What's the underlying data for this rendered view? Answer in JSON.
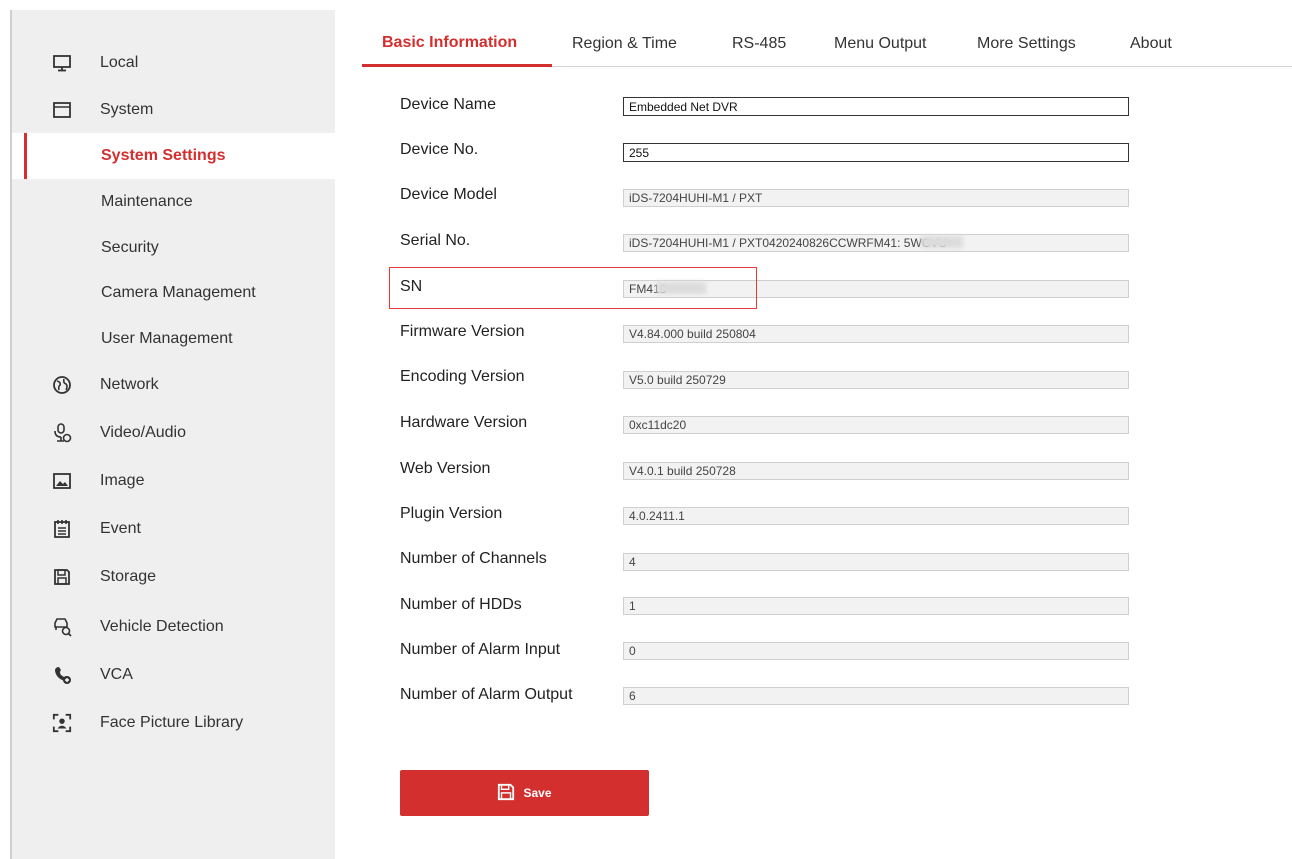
{
  "sidebar": {
    "items": [
      {
        "label": "Local",
        "icon": "monitor-icon"
      },
      {
        "label": "System",
        "icon": "window-icon"
      },
      {
        "label": "System Settings"
      },
      {
        "label": "Maintenance"
      },
      {
        "label": "Security"
      },
      {
        "label": "Camera Management"
      },
      {
        "label": "User Management"
      },
      {
        "label": "Network",
        "icon": "globe-icon"
      },
      {
        "label": "Video/Audio",
        "icon": "microphone-camera-icon"
      },
      {
        "label": "Image",
        "icon": "image-icon"
      },
      {
        "label": "Event",
        "icon": "calendar-icon"
      },
      {
        "label": "Storage",
        "icon": "floppy-icon"
      },
      {
        "label": "Vehicle Detection",
        "icon": "vehicle-search-icon"
      },
      {
        "label": "VCA",
        "icon": "vca-icon"
      },
      {
        "label": "Face Picture Library",
        "icon": "face-frame-icon"
      }
    ],
    "active_index": 2
  },
  "tabs": [
    {
      "label": "Basic Information"
    },
    {
      "label": "Region & Time"
    },
    {
      "label": "RS-485"
    },
    {
      "label": "Menu Output"
    },
    {
      "label": "More Settings"
    },
    {
      "label": "About"
    }
  ],
  "form": {
    "rows": [
      {
        "label": "Device Name",
        "value": "Embedded Net DVR"
      },
      {
        "label": "Device No.",
        "value": "255"
      },
      {
        "label": "Device Model",
        "value": "iDS-7204HUHI-M1 / PXT"
      },
      {
        "label": "Serial No.",
        "value": "iDS-7204HUHI-M1 / PXT0420240826CCWRFM41:    5WCVU"
      },
      {
        "label": "SN",
        "value": "FM413"
      },
      {
        "label": "Firmware Version",
        "value": "V4.84.000 build 250804"
      },
      {
        "label": "Encoding Version",
        "value": "V5.0 build 250729"
      },
      {
        "label": "Hardware Version",
        "value": "0xc11dc20"
      },
      {
        "label": "Web Version",
        "value": "V4.0.1 build 250728"
      },
      {
        "label": "Plugin Version",
        "value": "4.0.2411.1"
      },
      {
        "label": "Number of Channels",
        "value": "4"
      },
      {
        "label": "Number of HDDs",
        "value": "1"
      },
      {
        "label": "Number of Alarm Input",
        "value": "0"
      },
      {
        "label": "Number of Alarm Output",
        "value": "6"
      }
    ]
  },
  "save_label": "Save",
  "colors": {
    "accent": "#d32f2f",
    "sidebar_bg": "#efefef",
    "highlight": "#e53935"
  }
}
